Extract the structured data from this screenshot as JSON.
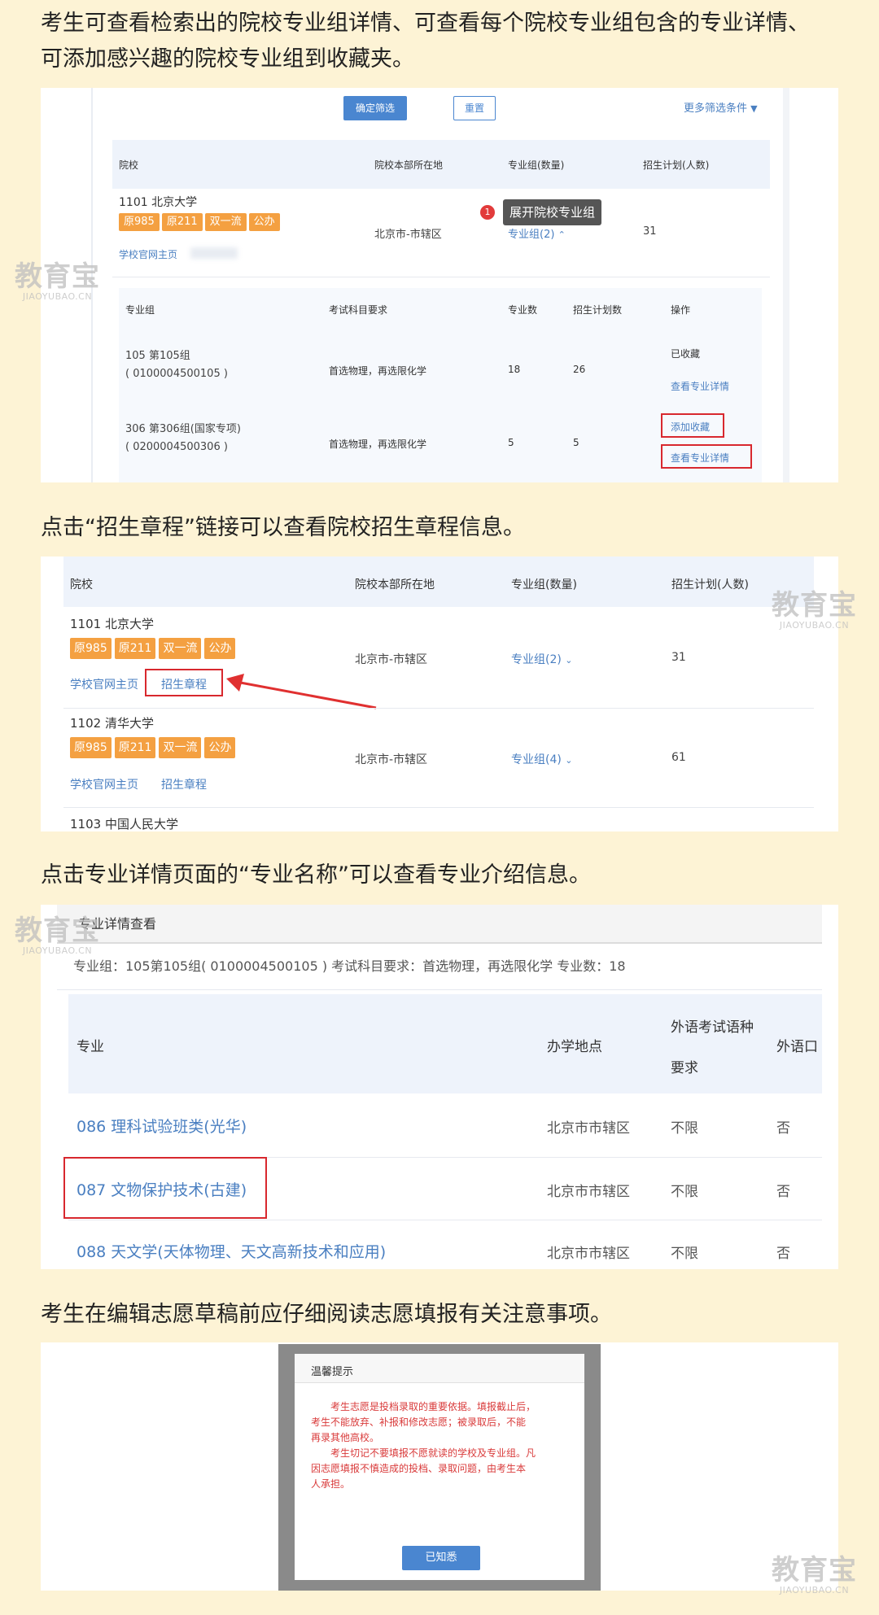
{
  "captions": {
    "c1_line1": "考生可查看检索出的院校专业组详情、可查看每个院校专业组包含的专业详情、",
    "c1_line2": "可添加感兴趣的院校专业组到收藏夹。",
    "c2": "点击“招生章程”链接可以查看院校招生章程信息。",
    "c3": "点击专业详情页面的“专业名称”可以查看专业介绍信息。",
    "c4": "考生在编辑志愿草稿前应仔细阅读志愿填报有关注意事项。"
  },
  "watermark": {
    "brand": "教育宝",
    "domain": "JIAOYUBAO.CN"
  },
  "panel1": {
    "confirm_button": "确定筛选",
    "reset_button": "重置",
    "more_filters": "更多筛选条件",
    "headers": [
      "院校",
      "院校本部所在地",
      "专业组(数量)",
      "招生计划(人数)"
    ],
    "school": {
      "name": "1101 北京大学",
      "tags": [
        "原985",
        "原211",
        "双一流",
        "公办"
      ],
      "homepage_link": "学校官网主页",
      "location": "北京市-市辖区",
      "groups_link": "专业组(2)",
      "plan": "31"
    },
    "tooltip_badge": "1",
    "tooltip": "展开院校专业组",
    "sub_headers": [
      "专业组",
      "考试科目要求",
      "专业数",
      "招生计划数",
      "操作"
    ],
    "groups": [
      {
        "name": "105 第105组",
        "code": "( 0100004500105 )",
        "subjects": "首选物理，再选限化学",
        "count": "18",
        "plan": "26",
        "action1": "已收藏",
        "action2": "查看专业详情"
      },
      {
        "name": "306 第306组(国家专项)",
        "code": "( 0200004500306 )",
        "subjects": "首选物理，再选限化学",
        "count": "5",
        "plan": "5",
        "action1": "添加收藏",
        "action2": "查看专业详情"
      }
    ]
  },
  "panel2": {
    "headers": [
      "院校",
      "院校本部所在地",
      "专业组(数量)",
      "招生计划(人数)"
    ],
    "schools": [
      {
        "name": "1101 北京大学",
        "tags": [
          "原985",
          "原211",
          "双一流",
          "公办"
        ],
        "homepage": "学校官网主页",
        "charter": "招生章程",
        "location": "北京市-市辖区",
        "groups": "专业组(2)",
        "plan": "31"
      },
      {
        "name": "1102 清华大学",
        "tags": [
          "原985",
          "原211",
          "双一流",
          "公办"
        ],
        "homepage": "学校官网主页",
        "charter": "招生章程",
        "location": "北京市-市辖区",
        "groups": "专业组(4)",
        "plan": "61"
      }
    ],
    "next_school": "1103 中国人民大学"
  },
  "panel3": {
    "title": "专业详情查看",
    "info": "专业组：105第105组( 0100004500105 )  考试科目要求：首选物理，再选限化学   专业数：18",
    "headers": {
      "major": "专业",
      "location": "办学地点",
      "lang_req_1": "外语考试语种",
      "lang_req_2": "要求",
      "oral": "外语口"
    },
    "rows": [
      {
        "major": "086 理科试验班类(光华)",
        "location": "北京市市辖区",
        "lang": "不限",
        "oral": "否"
      },
      {
        "major": "087 文物保护技术(古建)",
        "location": "北京市市辖区",
        "lang": "不限",
        "oral": "否"
      },
      {
        "major": "088 天文学(天体物理、天文高新技术和应用)",
        "location": "北京市市辖区",
        "lang": "不限",
        "oral": "否"
      }
    ]
  },
  "panel4": {
    "dialog_title": "温馨提示",
    "para1_lines": [
      "考生志愿是投档录取的重要依据。填报截止后，",
      "考生不能放弃、补报和修改志愿；被录取后，不能",
      "再录其他高校。"
    ],
    "para2_lines": [
      "考生切记不要填报不愿就读的学校及专业组。凡",
      "因志愿填报不慎造成的投档、录取问题，由考生本",
      "人承担。"
    ],
    "ok_button": "已知悉"
  }
}
